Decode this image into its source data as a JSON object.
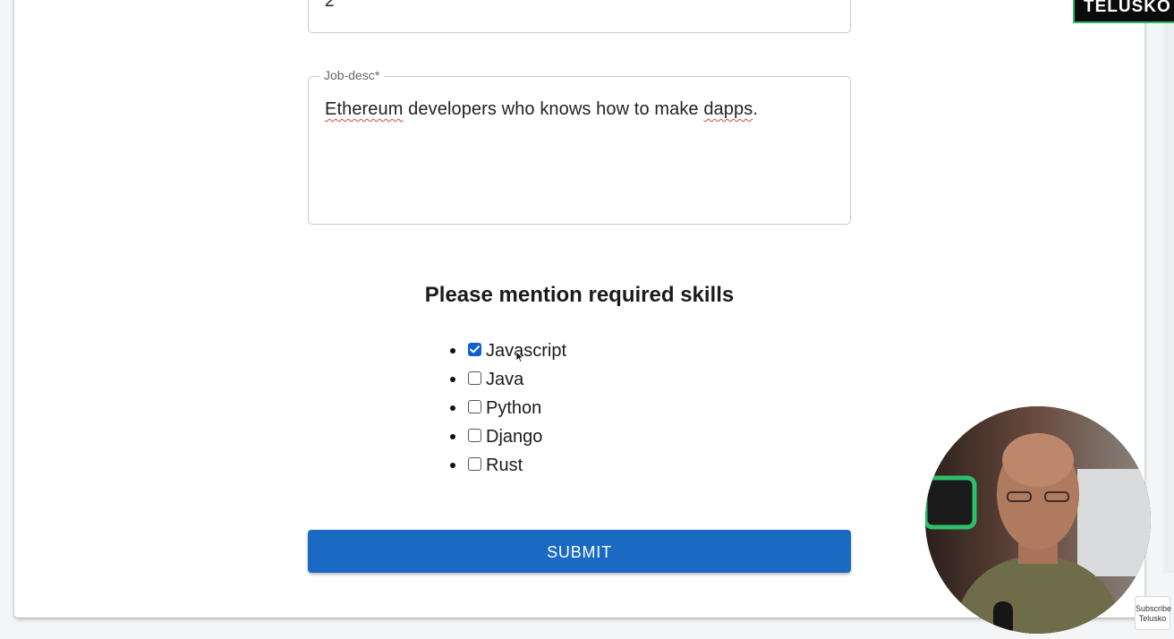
{
  "form": {
    "top_field_value": "2",
    "job_desc": {
      "label": "Job-desc",
      "required_mark": "*",
      "value_parts": [
        "Ethereum",
        " developers who knows how to make ",
        "dapps",
        "."
      ]
    },
    "skills_heading": "Please mention required skills",
    "skills": [
      {
        "label": "Javascript",
        "checked": true
      },
      {
        "label": "Java",
        "checked": false
      },
      {
        "label": "Python",
        "checked": false
      },
      {
        "label": "Django",
        "checked": false
      },
      {
        "label": "Rust",
        "checked": false
      }
    ],
    "submit_label": "SUBMIT"
  },
  "overlay": {
    "logo_text": "TELUSKO",
    "subscribe_line1": "Subscribe",
    "subscribe_line2": "Telusko",
    "icons": {
      "checkbox_checked": "checkmark-icon",
      "cursor": "mouse-pointer-icon"
    }
  },
  "colors": {
    "primary": "#1a6ac4",
    "checkbox_checked": "#0f5fd0",
    "logo_border": "#2cc06a",
    "spellcheck": "#e0443a"
  }
}
